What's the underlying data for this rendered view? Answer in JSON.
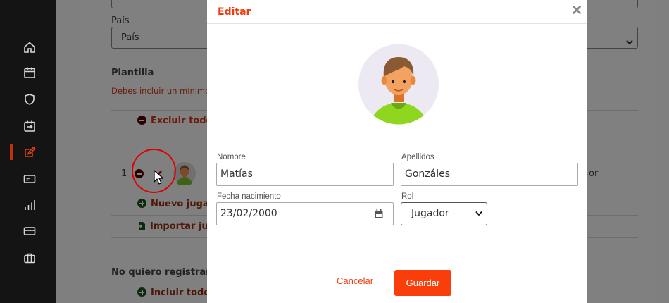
{
  "background_page": {
    "pais_label": "País",
    "pais_select_value": "País",
    "plantilla_heading": "Plantilla",
    "warning_text": "Debes incluir un mínimo d",
    "exclude_all": "Excluir todos",
    "row_number": "1",
    "right_partial": "or",
    "new_player": "Nuevo jugad",
    "import_players": "Importar jug",
    "no_register_heading": "No quiero registrar (e",
    "include_all": "Incluir todos"
  },
  "modal": {
    "title": "Editar",
    "fields": {
      "nombre": {
        "label": "Nombre",
        "value": "Matías"
      },
      "apellidos": {
        "label": "Apellidos",
        "value": "Gonzáles"
      },
      "fecha": {
        "label": "Fecha nacimiento",
        "value": "23/02/2000"
      },
      "rol": {
        "label": "Rol",
        "value": "Jugador"
      }
    },
    "cancel_label": "Cancelar",
    "save_label": "Guardar"
  },
  "colors": {
    "accent": "#fa3e0b",
    "title": "#f03c0c",
    "sidebar": "#141414",
    "overlay": "#808080"
  },
  "icons": {
    "sidebar": [
      "home-icon",
      "calendar-icon",
      "shield-icon",
      "calendar-swap-icon",
      "edit-icon",
      "ticket-icon",
      "bar-chart-icon",
      "card-icon",
      "briefcase-icon"
    ],
    "modal": [
      "close-icon",
      "avatar-icon",
      "calendar-icon",
      "chevron-down-icon"
    ]
  }
}
